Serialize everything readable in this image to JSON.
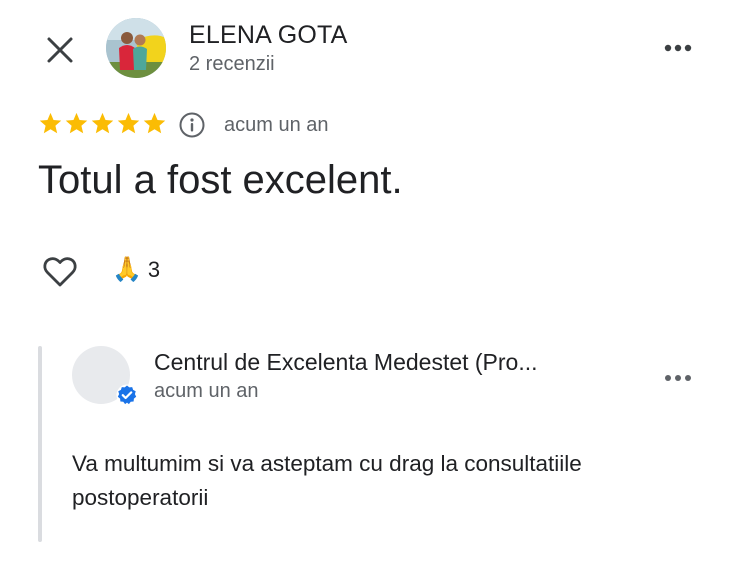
{
  "header": {
    "reviewer_name": "ELENA GOTA",
    "reviewer_sub": "2 recenzii",
    "close_icon": "close-icon",
    "more_icon": "more-horizontal-icon"
  },
  "review": {
    "rating": 5,
    "rating_max": 5,
    "star_color": "#fbbc04",
    "time": "acum un an",
    "text": "Totul a fost excelent.",
    "reaction_emoji": "🙏",
    "reaction_count": "3"
  },
  "owner_reply": {
    "name": "Centrul de Excelenta Medestet (Pro...",
    "time": "acum un an",
    "text": "Va multumim si va asteptam cu drag la consultatiile postoperatorii",
    "verified_color": "#1a73e8"
  }
}
